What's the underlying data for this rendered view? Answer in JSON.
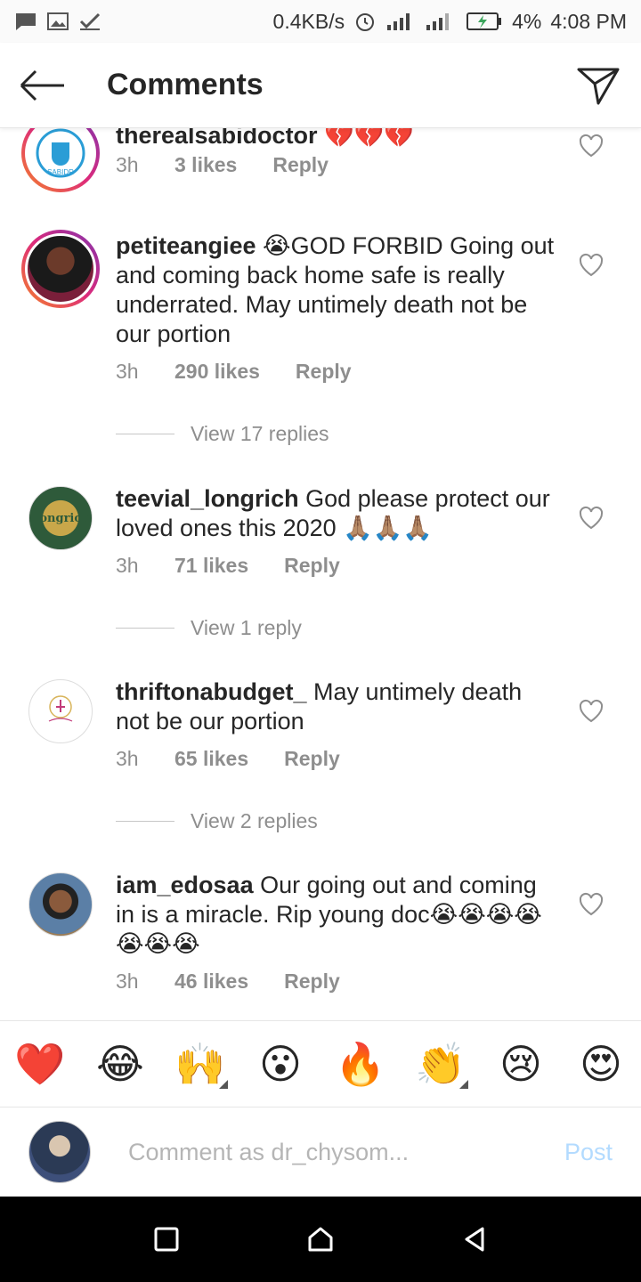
{
  "status_bar": {
    "speed": "0.4KB/s",
    "battery": "4%",
    "time": "4:08 PM"
  },
  "header": {
    "title": "Comments"
  },
  "comments": [
    {
      "username": "therealsabidoctor",
      "text": " 💔💔💔",
      "time": "3h",
      "likes": "3 likes",
      "reply": "Reply",
      "avatar_label": "SABIDR"
    },
    {
      "username": "petiteangiee",
      "text": " 😭GOD FORBID Going out and coming back home safe is really underrated. May untimely death not be our portion",
      "time": "3h",
      "likes": "290 likes",
      "reply": "Reply",
      "view_replies": "View 17 replies"
    },
    {
      "username": "teevial_longrich",
      "text": " God please protect our loved ones this 2020 🙏🏽🙏🏽🙏🏽",
      "time": "3h",
      "likes": "71 likes",
      "reply": "Reply",
      "view_replies": "View 1 reply",
      "avatar_label": "Longrich"
    },
    {
      "username": "thriftonabudget_",
      "text": " May untimely death not be our portion",
      "time": "3h",
      "likes": "65 likes",
      "reply": "Reply",
      "view_replies": "View 2 replies"
    },
    {
      "username": "iam_edosaa",
      "text": " Our going out and coming in is a miracle. Rip young doc😭😭😭😭😭😭😭",
      "time": "3h",
      "likes": "46 likes",
      "reply": "Reply"
    }
  ],
  "emoji_bar": [
    "❤️",
    "😂",
    "🙌",
    "😮",
    "🔥",
    "👏",
    "😢",
    "😍"
  ],
  "comment_input": {
    "placeholder": "Comment as dr_chysom...",
    "post_label": "Post"
  },
  "colors": {
    "accent": "#b3dbff",
    "text": "#262626",
    "muted": "#8e8e8e"
  }
}
